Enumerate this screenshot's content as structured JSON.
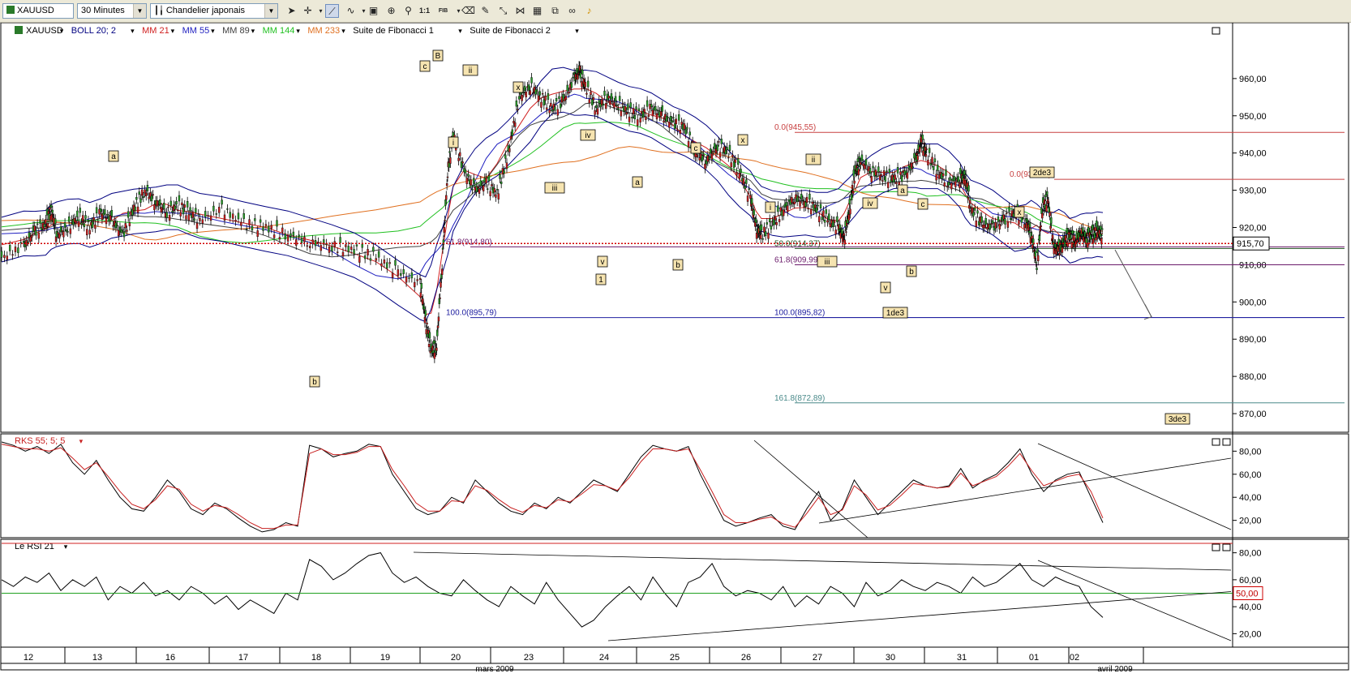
{
  "toolbar": {
    "symbol": "XAUUSD",
    "interval": "30 Minutes",
    "chart_style": "Chandelier japonais",
    "icons": [
      "cursor-arrow-icon",
      "crosshair-icon",
      "trendline-icon",
      "drawing-tools-icon",
      "zoom-box-icon",
      "zoom-icon",
      "zoom-1to1-label",
      "fib-label",
      "eraser-icon",
      "arrows-icon",
      "magnet-icon",
      "grid-icon",
      "alert-icon",
      "link-icon",
      "bell-icon"
    ],
    "zoom_1to1": "1:1",
    "fib": "FIB"
  },
  "chart_data": [
    {
      "type": "candlestick",
      "panel": "price",
      "symbol": "XAUUSD",
      "legend": [
        {
          "label": "XAUUSD",
          "color": "#000000"
        },
        {
          "label": "BOLL  20; 2",
          "color": "#000080"
        },
        {
          "label": "MM 21",
          "color": "#d02020"
        },
        {
          "label": "MM 55",
          "color": "#2020c0"
        },
        {
          "label": "MM 89",
          "color": "#404040"
        },
        {
          "label": "MM 144",
          "color": "#20c020"
        },
        {
          "label": "MM 233",
          "color": "#e07020"
        },
        {
          "label": "Suite de Fibonacci 1",
          "color": "#000000"
        },
        {
          "label": "Suite de Fibonacci 2",
          "color": "#000000"
        }
      ],
      "yaxis": {
        "ticks": [
          "960,00",
          "950,00",
          "940,00",
          "930,00",
          "920,00",
          "910,00",
          "900,00",
          "890,00",
          "880,00",
          "870,00"
        ],
        "range": [
          865,
          975
        ]
      },
      "current_price": {
        "value": 915.7,
        "label": "915,70"
      },
      "x_labels": [
        "12",
        "13",
        "16",
        "17",
        "18",
        "19",
        "20",
        "23",
        "24",
        "25",
        "26",
        "27",
        "30",
        "31",
        "01",
        "02"
      ],
      "month_labels": [
        "mars 2009",
        "avril 2009"
      ],
      "price_path": [
        [
          0,
          912
        ],
        [
          0.02,
          915
        ],
        [
          0.03,
          919
        ],
        [
          0.04,
          921
        ],
        [
          0.045,
          925
        ],
        [
          0.05,
          918
        ],
        [
          0.06,
          920
        ],
        [
          0.07,
          923
        ],
        [
          0.08,
          920
        ],
        [
          0.09,
          924
        ],
        [
          0.1,
          922
        ],
        [
          0.11,
          918
        ],
        [
          0.12,
          925
        ],
        [
          0.13,
          930
        ],
        [
          0.14,
          927
        ],
        [
          0.15,
          924
        ],
        [
          0.16,
          926
        ],
        [
          0.17,
          924
        ],
        [
          0.18,
          922
        ],
        [
          0.2,
          925
        ],
        [
          0.22,
          921
        ],
        [
          0.24,
          920
        ],
        [
          0.26,
          918
        ],
        [
          0.28,
          916
        ],
        [
          0.3,
          915
        ],
        [
          0.32,
          914
        ],
        [
          0.34,
          912
        ],
        [
          0.36,
          908
        ],
        [
          0.38,
          905
        ],
        [
          0.385,
          895
        ],
        [
          0.39,
          887
        ],
        [
          0.395,
          888
        ],
        [
          0.4,
          910
        ],
        [
          0.405,
          935
        ],
        [
          0.41,
          945
        ],
        [
          0.42,
          935
        ],
        [
          0.43,
          930
        ],
        [
          0.44,
          932
        ],
        [
          0.45,
          929
        ],
        [
          0.46,
          940
        ],
        [
          0.47,
          955
        ],
        [
          0.48,
          958
        ],
        [
          0.49,
          955
        ],
        [
          0.5,
          952
        ],
        [
          0.51,
          954
        ],
        [
          0.52,
          960
        ],
        [
          0.525,
          962
        ],
        [
          0.53,
          958
        ],
        [
          0.54,
          952
        ],
        [
          0.55,
          955
        ],
        [
          0.56,
          953
        ],
        [
          0.57,
          951
        ],
        [
          0.58,
          950
        ],
        [
          0.59,
          952
        ],
        [
          0.6,
          950
        ],
        [
          0.61,
          948
        ],
        [
          0.62,
          947
        ],
        [
          0.63,
          940
        ],
        [
          0.64,
          938
        ],
        [
          0.65,
          942
        ],
        [
          0.66,
          940
        ],
        [
          0.67,
          935
        ],
        [
          0.68,
          928
        ],
        [
          0.685,
          920
        ],
        [
          0.69,
          918
        ],
        [
          0.7,
          921
        ],
        [
          0.71,
          925
        ],
        [
          0.72,
          928
        ],
        [
          0.73,
          927
        ],
        [
          0.74,
          925
        ],
        [
          0.75,
          922
        ],
        [
          0.76,
          920
        ],
        [
          0.765,
          917
        ],
        [
          0.77,
          925
        ],
        [
          0.775,
          935
        ],
        [
          0.78,
          938
        ],
        [
          0.79,
          935
        ],
        [
          0.8,
          934
        ],
        [
          0.81,
          933
        ],
        [
          0.82,
          934
        ],
        [
          0.83,
          938
        ],
        [
          0.835,
          943
        ],
        [
          0.84,
          940
        ],
        [
          0.85,
          935
        ],
        [
          0.86,
          932
        ],
        [
          0.87,
          933
        ],
        [
          0.875,
          934
        ],
        [
          0.88,
          925
        ],
        [
          0.89,
          921
        ],
        [
          0.9,
          920
        ],
        [
          0.91,
          922
        ],
        [
          0.92,
          924
        ],
        [
          0.93,
          922
        ],
        [
          0.935,
          918
        ],
        [
          0.94,
          910
        ],
        [
          0.945,
          925
        ],
        [
          0.95,
          928
        ],
        [
          0.955,
          915
        ],
        [
          0.96,
          914
        ],
        [
          0.965,
          916
        ],
        [
          0.97,
          918
        ],
        [
          0.975,
          916
        ],
        [
          0.98,
          919
        ],
        [
          0.985,
          917
        ],
        [
          0.99,
          918
        ],
        [
          0.995,
          919
        ],
        [
          1.0,
          918
        ]
      ],
      "annotations": [
        {
          "text": "a",
          "pos": "x13-high"
        },
        {
          "text": "b",
          "pos": "x18-low"
        },
        {
          "text": "c",
          "pos": "x20-high"
        },
        {
          "text": "B",
          "pos": "x20-top"
        },
        {
          "text": "ii",
          "pos": "x20b"
        },
        {
          "text": "i",
          "pos": "x20c"
        },
        {
          "text": "x",
          "pos": "x23"
        },
        {
          "text": "iii",
          "pos": "x23b"
        },
        {
          "text": "iv",
          "pos": "x24"
        },
        {
          "text": "v",
          "pos": "x24b"
        },
        {
          "text": "1",
          "pos": "x24c"
        },
        {
          "text": "a",
          "pos": "x24d"
        },
        {
          "text": "b",
          "pos": "x25"
        },
        {
          "text": "c",
          "pos": "x25b"
        },
        {
          "text": "x",
          "pos": "x26"
        },
        {
          "text": "i",
          "pos": "x27"
        },
        {
          "text": "ii",
          "pos": "x27b"
        },
        {
          "text": "iii",
          "pos": "x27c"
        },
        {
          "text": "iv",
          "pos": "x30"
        },
        {
          "text": "a",
          "pos": "x30b"
        },
        {
          "text": "v",
          "pos": "x30c"
        },
        {
          "text": "b",
          "pos": "x30d"
        },
        {
          "text": "c",
          "pos": "x30e"
        },
        {
          "text": "1de3",
          "pos": "x30f"
        },
        {
          "text": "x",
          "pos": "x01"
        },
        {
          "text": "2de3",
          "pos": "x01b"
        },
        {
          "text": "3de3",
          "pos": "x02"
        }
      ],
      "fib_levels": [
        {
          "label": "0.0(945,55)",
          "value": 945.55,
          "color": "#c84040"
        },
        {
          "label": "0.0(932,92)",
          "value": 932.92,
          "color": "#c84040"
        },
        {
          "label": "61.8(914,80)",
          "value": 914.8,
          "color": "#6a1a6a"
        },
        {
          "label": "50.0(914,37)",
          "value": 914.37,
          "color": "#205020"
        },
        {
          "label": "61.8(909,99)",
          "value": 909.99,
          "color": "#6a1a6a"
        },
        {
          "label": "100.0(895,79)",
          "value": 895.79,
          "color": "#2020a0"
        },
        {
          "label": "100.0(895,82)",
          "value": 895.82,
          "color": "#2020a0"
        },
        {
          "label": "161.8(872,89)",
          "value": 872.89,
          "color": "#4a8a8a"
        }
      ]
    },
    {
      "type": "line",
      "panel": "stochastic",
      "legend": "RKS 55; 5; 5",
      "yaxis": {
        "ticks": [
          "80,00",
          "60,00",
          "40,00",
          "20,00"
        ],
        "range": [
          5,
          95
        ]
      },
      "series": [
        {
          "color": "#000000",
          "values": [
            88,
            85,
            80,
            84,
            78,
            86,
            70,
            60,
            72,
            55,
            40,
            30,
            28,
            40,
            55,
            45,
            30,
            25,
            35,
            30,
            22,
            15,
            10,
            12,
            18,
            15,
            85,
            82,
            75,
            78,
            80,
            86,
            84,
            60,
            45,
            30,
            25,
            28,
            40,
            35,
            55,
            45,
            35,
            28,
            25,
            35,
            30,
            40,
            35,
            45,
            55,
            50,
            45,
            60,
            75,
            85,
            82,
            80,
            84,
            60,
            40,
            20,
            15,
            18,
            22,
            25,
            15,
            12,
            30,
            45,
            20,
            30,
            55,
            40,
            25,
            35,
            45,
            55,
            50,
            48,
            50,
            65,
            48,
            55,
            60,
            70,
            82,
            60,
            45,
            55,
            60,
            62,
            40,
            18
          ]
        },
        {
          "color": "#c82020",
          "values": [
            86,
            84,
            82,
            82,
            80,
            83,
            74,
            64,
            70,
            58,
            45,
            34,
            30,
            38,
            50,
            47,
            34,
            28,
            33,
            31,
            25,
            18,
            13,
            13,
            16,
            16,
            78,
            82,
            77,
            77,
            79,
            84,
            84,
            64,
            50,
            35,
            28,
            28,
            37,
            36,
            50,
            46,
            38,
            31,
            27,
            33,
            31,
            38,
            36,
            43,
            51,
            50,
            46,
            57,
            71,
            82,
            82,
            80,
            82,
            64,
            45,
            25,
            18,
            18,
            21,
            23,
            17,
            14,
            26,
            40,
            25,
            29,
            50,
            42,
            29,
            33,
            42,
            52,
            50,
            48,
            49,
            61,
            50,
            54,
            58,
            67,
            78,
            63,
            50,
            54,
            58,
            60,
            45,
            22
          ]
        }
      ]
    },
    {
      "type": "line",
      "panel": "rsi",
      "legend": "Le RSI 21",
      "yaxis": {
        "ticks": [
          "80,00",
          "60,00",
          "40,00",
          "20,00"
        ],
        "range": [
          10,
          90
        ]
      },
      "level": {
        "value": 50,
        "label": "50,00"
      },
      "series": [
        {
          "color": "#000000",
          "values": [
            60,
            55,
            62,
            58,
            65,
            52,
            60,
            55,
            62,
            45,
            55,
            50,
            58,
            48,
            52,
            45,
            55,
            50,
            42,
            48,
            38,
            45,
            40,
            35,
            50,
            45,
            75,
            70,
            60,
            65,
            72,
            78,
            80,
            65,
            58,
            62,
            55,
            50,
            48,
            60,
            52,
            45,
            40,
            55,
            48,
            42,
            58,
            45,
            35,
            25,
            30,
            40,
            48,
            55,
            45,
            62,
            50,
            40,
            58,
            62,
            72,
            55,
            48,
            52,
            50,
            45,
            55,
            40,
            48,
            42,
            55,
            50,
            40,
            58,
            48,
            52,
            60,
            55,
            52,
            58,
            55,
            50,
            62,
            55,
            58,
            65,
            72,
            60,
            55,
            62,
            58,
            55,
            40,
            32
          ]
        }
      ]
    }
  ]
}
